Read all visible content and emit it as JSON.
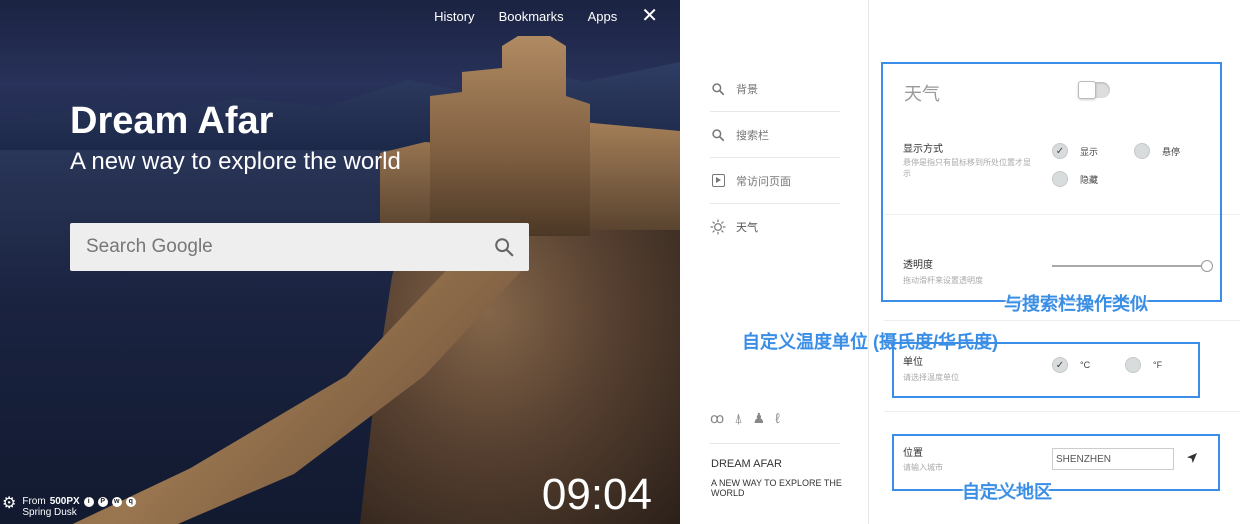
{
  "newtab": {
    "nav": {
      "history": "History",
      "bookmarks": "Bookmarks",
      "apps": "Apps",
      "close": "✕"
    },
    "title": "Dream Afar",
    "subtitle": "A new way to explore the world",
    "search_placeholder": "Search Google",
    "credit": {
      "from": "From",
      "source": "500PX",
      "photo_name": "Spring Dusk"
    },
    "clock": "09:04"
  },
  "settings": {
    "menu": [
      {
        "icon": "search-icon",
        "label": "背景"
      },
      {
        "icon": "search-icon",
        "label": "搜索栏"
      },
      {
        "icon": "play-icon",
        "label": "常访问页面"
      },
      {
        "icon": "sun-icon",
        "label": "天气"
      }
    ],
    "brand": "DREAM AFAR",
    "tagline": "A NEW WAY TO EXPLORE THE WORLD",
    "weather": {
      "heading": "天气",
      "enabled": false,
      "display_mode": {
        "label": "显示方式",
        "desc": "悬停是指只有鼠标移到所处位置才显示",
        "options": [
          "显示",
          "悬停",
          "隐藏"
        ],
        "selected": "显示"
      },
      "opacity": {
        "label": "透明度",
        "desc": "拖动滑杆来设置透明度",
        "value": 1.0
      },
      "unit": {
        "label": "单位",
        "desc": "请选择温度单位",
        "options": [
          "°C",
          "°F"
        ],
        "selected": "°C"
      },
      "location": {
        "label": "位置",
        "desc": "请输入城市",
        "value": "SHENZHEN"
      }
    },
    "annotations": {
      "a1": "与搜索栏操作类似",
      "a2": "自定义温度单位 (摄氏度/华氏度)",
      "a3": "自定义地区"
    },
    "colors": {
      "annotation": "#3a8ee6"
    }
  }
}
